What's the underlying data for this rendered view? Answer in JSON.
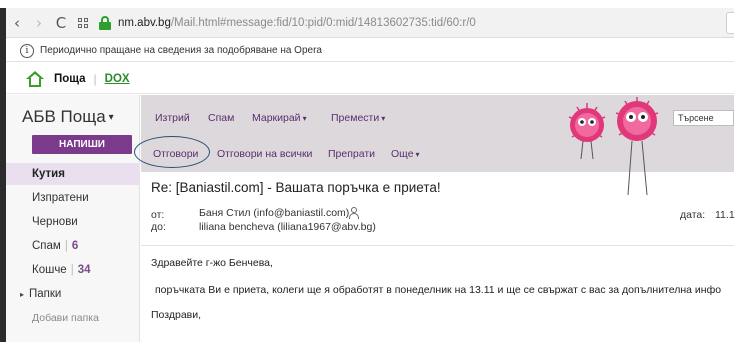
{
  "browser": {
    "back_icon": "‹",
    "forward_icon": "›",
    "reload_icon": "C",
    "url_host": "nm.abv.bg",
    "url_path": "/Mail.html#message:fid/10:pid/0:mid/14813602735:tid/60:r/0"
  },
  "info_bar": {
    "icon_glyph": "i",
    "text": "Периодично пращане на сведения за подобряване на Opera"
  },
  "site_header": {
    "mail_link": "Поща",
    "separator": "|",
    "dox_link": "DOX"
  },
  "sidebar": {
    "brand": "АБВ Поща",
    "brand_caret": "▾",
    "compose_label": "НАПИШИ",
    "folders": [
      {
        "label": "Кутия"
      },
      {
        "label": "Изпратени"
      },
      {
        "label": "Чернови"
      },
      {
        "label": "Спам",
        "count": "6"
      },
      {
        "label": "Кошче",
        "count": "34"
      },
      {
        "label": "Папки"
      }
    ],
    "count_separator": "|",
    "folders_toggle": "▸",
    "add_folder": "Добави папка"
  },
  "toolbar": {
    "delete": "Изтрий",
    "spam": "Спам",
    "mark": "Маркирай",
    "move": "Премести",
    "reply": "Отговори",
    "reply_all": "Отговори на всички",
    "forward": "Препрати",
    "more": "Още",
    "caret": "▾",
    "search_placeholder": "Търсене"
  },
  "message": {
    "subject": "Re: [Baniastil.com] - Вашата поръчка е приета!",
    "from_label": "от:",
    "from_value": "Баня Стил (info@baniastil.com)",
    "to_label": "до:",
    "to_value": "liliana bencheva (liliana1967@abv.bg)",
    "date_label": "дата:",
    "date_value": "11.1",
    "greeting": "Здравейте г-жо Бенчева,",
    "body": "поръчката Ви е приета, колеги ще я обработят в понеделник на 13.11 и ще се свържат с вас за допълнителна инфо",
    "closing": "Поздрави,"
  },
  "colors": {
    "accent": "#7b3a8c",
    "toolbar_bg": "#dcd8dc",
    "secure_green": "#2e9e2e",
    "annotation_circle": "#2a4f7a"
  }
}
